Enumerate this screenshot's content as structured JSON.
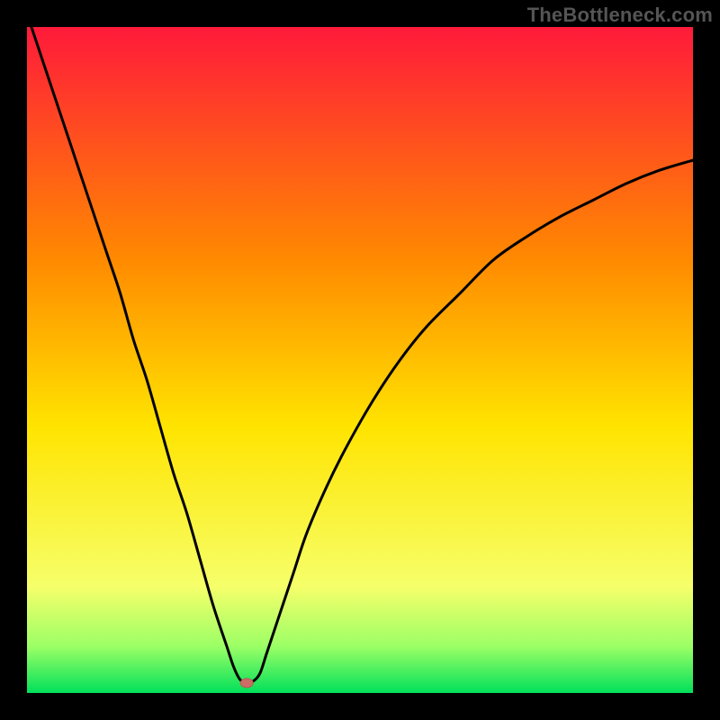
{
  "watermark": "TheBottleneck.com",
  "colors": {
    "frame": "#000000",
    "gradient_top": "#ff1a3a",
    "gradient_mid1": "#ff8a00",
    "gradient_mid2": "#ffe400",
    "gradient_mid3": "#f6ff6a",
    "gradient_band": "#9cff66",
    "gradient_bottom": "#00e05a",
    "curve": "#000000",
    "dot_fill": "#cc6e66",
    "dot_stroke": "#b85a52"
  },
  "chart_data": {
    "type": "line",
    "title": "",
    "xlabel": "",
    "ylabel": "",
    "xlim": [
      0,
      1
    ],
    "ylim": [
      0,
      1
    ],
    "series": [
      {
        "name": "bottleneck-curve",
        "x": [
          0.0,
          0.02,
          0.04,
          0.06,
          0.08,
          0.1,
          0.12,
          0.14,
          0.16,
          0.18,
          0.2,
          0.22,
          0.24,
          0.26,
          0.28,
          0.3,
          0.31,
          0.32,
          0.33,
          0.34,
          0.35,
          0.36,
          0.38,
          0.4,
          0.42,
          0.45,
          0.48,
          0.52,
          0.56,
          0.6,
          0.65,
          0.7,
          0.75,
          0.8,
          0.85,
          0.9,
          0.95,
          1.0
        ],
        "y": [
          1.02,
          0.96,
          0.9,
          0.84,
          0.78,
          0.72,
          0.66,
          0.6,
          0.53,
          0.47,
          0.4,
          0.33,
          0.27,
          0.2,
          0.13,
          0.07,
          0.04,
          0.02,
          0.015,
          0.018,
          0.03,
          0.06,
          0.12,
          0.18,
          0.24,
          0.31,
          0.37,
          0.44,
          0.5,
          0.55,
          0.6,
          0.65,
          0.685,
          0.715,
          0.74,
          0.765,
          0.785,
          0.8
        ]
      }
    ],
    "marker": {
      "x": 0.33,
      "y": 0.015
    },
    "notes": "Values are normalized fractions of the plot area (0=left/bottom, 1=right/top). Curve left-end y exceeds 1.0 indicating it enters from above the visible plot."
  }
}
